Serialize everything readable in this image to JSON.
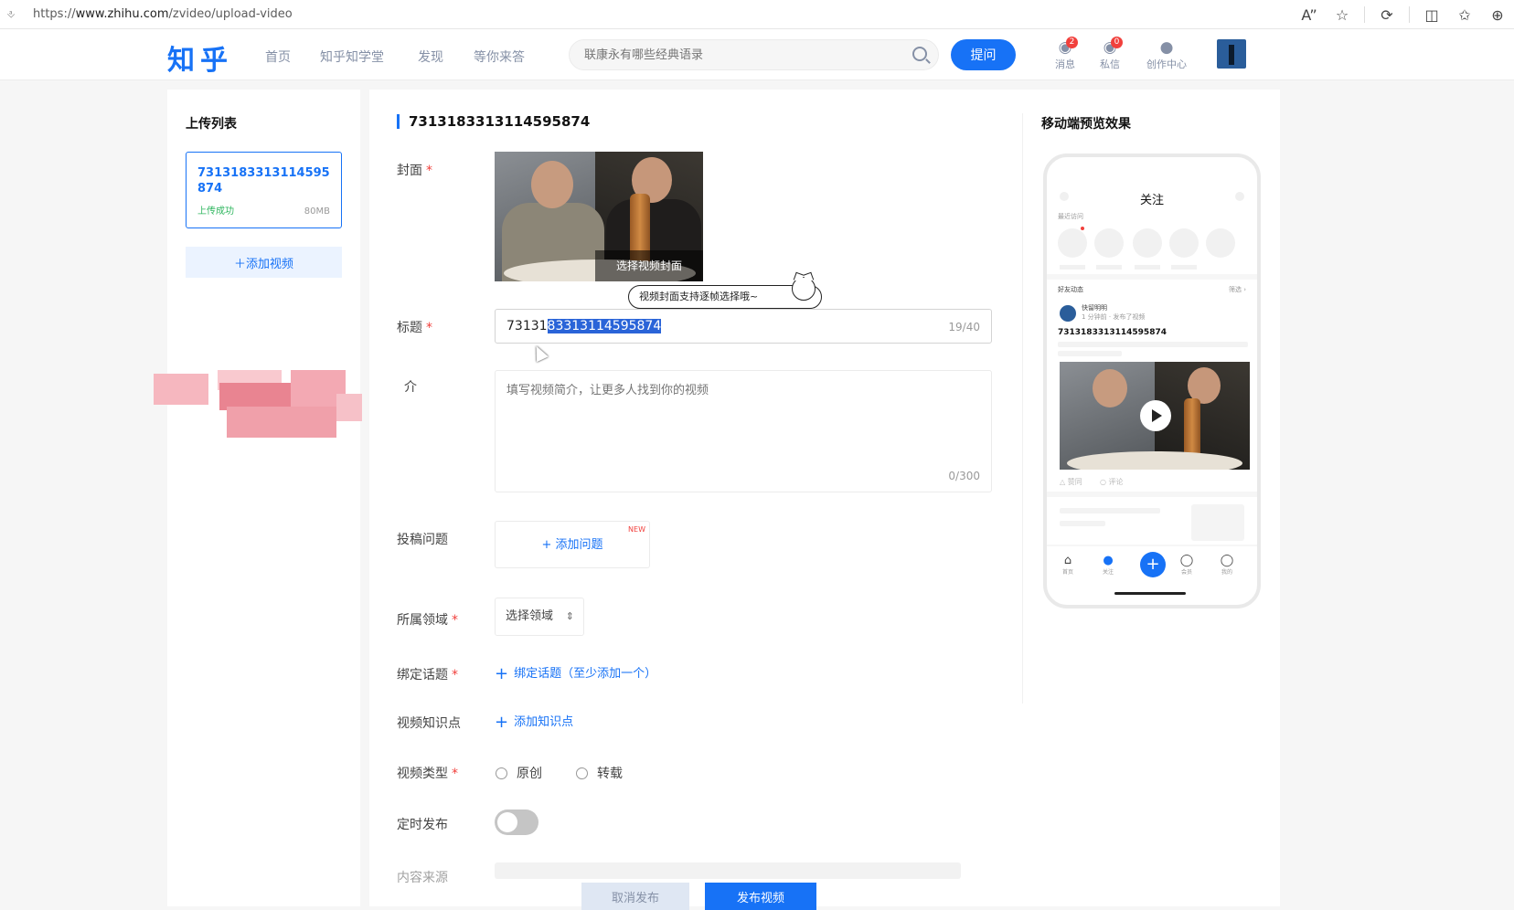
{
  "browser": {
    "url_prefix": "https://",
    "url_host": "www.zhihu.com",
    "url_path": "/zvideo/upload-video",
    "icons": [
      "read-aloud-icon",
      "favorite-star-icon",
      "refresh-icon",
      "split-screen-icon",
      "favorites-icon",
      "extensions-icon"
    ]
  },
  "topnav": {
    "logo": "知乎",
    "links": [
      "首页",
      "知乎知学堂",
      "发现",
      "等你来答"
    ],
    "search_placeholder": "联康永有哪些经典语录",
    "ask_label": "提问",
    "messages": {
      "label": "消息",
      "badge": "2"
    },
    "inbox": {
      "label": "私信",
      "badge": "0"
    },
    "creator": {
      "label": "创作中心"
    }
  },
  "left": {
    "title": "上传列表",
    "card_name": "7313183313114595874",
    "card_status": "上传成功",
    "card_size": "80MB",
    "add_label": "＋添加视频"
  },
  "form": {
    "heading": "7313183313114595874",
    "cover_label": "封面",
    "cover_overlay": "选择视频封面",
    "tooltip": "视频封面支持逐帧选择哦~",
    "title_label": "标题",
    "title_plain": "73131",
    "title_selected": "83313114595874",
    "title_count": "19/40",
    "desc_label": "介",
    "desc_placeholder": "填写视频简介，让更多人找到你的视频",
    "desc_count": "0/300",
    "question_label": "投稿问题",
    "question_add": "+ 添加问题",
    "question_new": "NEW",
    "domain_label": "所属领域",
    "domain_select": "选择领域",
    "topic_label": "绑定话题",
    "topic_add": "绑定话题（至少添加一个）",
    "knowledge_label": "视频知识点",
    "knowledge_add": "添加知识点",
    "type_label": "视频类型",
    "type_original": "原创",
    "type_repost": "转载",
    "schedule_label": "定时发布",
    "source_label": "内容来源",
    "cancel_label": "取消发布",
    "publish_label": "发布视频"
  },
  "preview": {
    "title": "移动端预览效果",
    "phone_header": "关注",
    "recent_label": "最近访问",
    "feed_label": "好友动态",
    "feed_more": "筛选 ›",
    "user_name": "快留明明",
    "user_meta": "1 分钟前 · 发布了视频",
    "video_title": "7313183313114595874",
    "like_label": "赞同",
    "comment_label": "评论",
    "tabs": [
      "首页",
      "关注",
      "会员",
      "我的"
    ]
  }
}
